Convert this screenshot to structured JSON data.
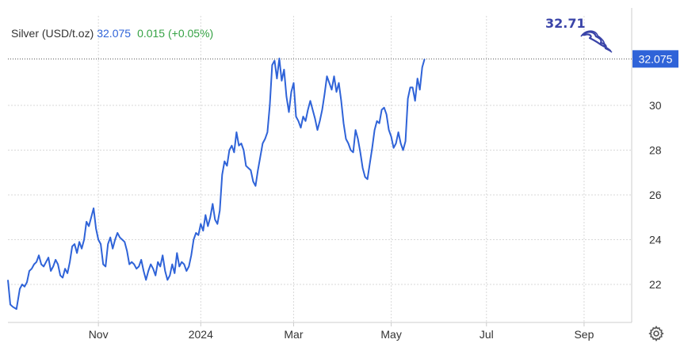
{
  "legend": {
    "name": "Silver (USD/t.oz)",
    "price": "32.075",
    "change": "0.015 (+0.05%)"
  },
  "annotation": "32.71",
  "colors": {
    "line": "#2f63d8",
    "change_positive": "#35a244",
    "grid": "#d9d9d9",
    "axis": "#cccccc",
    "annotation": "#3a44a8",
    "price_tag": "#2f63d8"
  },
  "icons": {
    "settings": "gear-icon"
  },
  "chart_data": {
    "type": "line",
    "title": "",
    "xlabel": "",
    "ylabel": "",
    "ylim": [
      20.3,
      34.0
    ],
    "yticks": [
      22,
      24,
      26,
      28,
      30
    ],
    "y_tick_labels": [
      "22",
      "24",
      "26",
      "28",
      "30"
    ],
    "x_ticks": [
      {
        "label": "Nov",
        "x": 10.1
      },
      {
        "label": "2024",
        "x": 12.25
      },
      {
        "label": "Mar",
        "x": 14.2
      },
      {
        "label": "May",
        "x": 16.25
      },
      {
        "label": "Jul",
        "x": 18.25
      },
      {
        "label": "Sep",
        "x": 20.3
      }
    ],
    "xlim": [
      8.2,
      21.3
    ],
    "grid": true,
    "current_price": 32.075,
    "last_price_line": 32.075,
    "series": [
      {
        "values": [
          [
            8.2,
            22.2
          ],
          [
            8.25,
            21.1
          ],
          [
            8.3,
            21.0
          ],
          [
            8.38,
            20.9
          ],
          [
            8.45,
            21.8
          ],
          [
            8.5,
            22.0
          ],
          [
            8.55,
            21.9
          ],
          [
            8.6,
            22.1
          ],
          [
            8.65,
            22.6
          ],
          [
            8.7,
            22.7
          ],
          [
            8.75,
            22.9
          ],
          [
            8.8,
            23.0
          ],
          [
            8.85,
            23.3
          ],
          [
            8.9,
            22.9
          ],
          [
            8.95,
            22.8
          ],
          [
            9.0,
            23.0
          ],
          [
            9.05,
            23.2
          ],
          [
            9.1,
            22.6
          ],
          [
            9.15,
            22.8
          ],
          [
            9.2,
            23.1
          ],
          [
            9.25,
            22.9
          ],
          [
            9.3,
            22.4
          ],
          [
            9.35,
            22.3
          ],
          [
            9.4,
            22.7
          ],
          [
            9.45,
            22.5
          ],
          [
            9.5,
            23.0
          ],
          [
            9.55,
            23.7
          ],
          [
            9.6,
            23.8
          ],
          [
            9.65,
            23.4
          ],
          [
            9.7,
            23.9
          ],
          [
            9.75,
            23.6
          ],
          [
            9.8,
            24.0
          ],
          [
            9.85,
            24.8
          ],
          [
            9.9,
            24.6
          ],
          [
            9.95,
            25.0
          ],
          [
            10.0,
            25.4
          ],
          [
            10.05,
            24.5
          ],
          [
            10.1,
            24.0
          ],
          [
            10.15,
            23.8
          ],
          [
            10.2,
            22.9
          ],
          [
            10.25,
            22.8
          ],
          [
            10.3,
            23.8
          ],
          [
            10.35,
            24.1
          ],
          [
            10.4,
            23.6
          ],
          [
            10.45,
            24.0
          ],
          [
            10.5,
            24.3
          ],
          [
            10.55,
            24.1
          ],
          [
            10.6,
            24.0
          ],
          [
            10.65,
            23.9
          ],
          [
            10.7,
            23.5
          ],
          [
            10.75,
            22.9
          ],
          [
            10.8,
            23.0
          ],
          [
            10.85,
            22.9
          ],
          [
            10.9,
            22.7
          ],
          [
            10.95,
            22.8
          ],
          [
            11.0,
            23.1
          ],
          [
            11.05,
            22.6
          ],
          [
            11.1,
            22.2
          ],
          [
            11.15,
            22.6
          ],
          [
            11.2,
            22.9
          ],
          [
            11.25,
            22.7
          ],
          [
            11.3,
            22.4
          ],
          [
            11.35,
            23.0
          ],
          [
            11.4,
            22.8
          ],
          [
            11.45,
            23.3
          ],
          [
            11.5,
            22.6
          ],
          [
            11.55,
            22.2
          ],
          [
            11.6,
            22.4
          ],
          [
            11.65,
            22.9
          ],
          [
            11.7,
            22.5
          ],
          [
            11.75,
            23.4
          ],
          [
            11.8,
            22.8
          ],
          [
            11.85,
            23.0
          ],
          [
            11.9,
            22.9
          ],
          [
            11.95,
            22.6
          ],
          [
            12.0,
            22.8
          ],
          [
            12.05,
            23.3
          ],
          [
            12.1,
            24.0
          ],
          [
            12.15,
            24.3
          ],
          [
            12.2,
            24.2
          ],
          [
            12.25,
            24.7
          ],
          [
            12.3,
            24.4
          ],
          [
            12.35,
            25.1
          ],
          [
            12.4,
            24.6
          ],
          [
            12.45,
            25.0
          ],
          [
            12.5,
            25.6
          ],
          [
            12.55,
            24.9
          ],
          [
            12.6,
            24.7
          ],
          [
            12.65,
            25.3
          ],
          [
            12.7,
            26.9
          ],
          [
            12.75,
            27.5
          ],
          [
            12.8,
            27.3
          ],
          [
            12.85,
            28.0
          ],
          [
            12.9,
            28.2
          ],
          [
            12.95,
            27.9
          ],
          [
            13.0,
            28.8
          ],
          [
            13.05,
            28.2
          ],
          [
            13.1,
            28.3
          ],
          [
            13.15,
            28.0
          ],
          [
            13.2,
            27.3
          ],
          [
            13.25,
            27.2
          ],
          [
            13.3,
            27.1
          ],
          [
            13.35,
            26.6
          ],
          [
            13.4,
            26.4
          ],
          [
            13.45,
            27.1
          ],
          [
            13.5,
            27.7
          ],
          [
            13.55,
            28.3
          ],
          [
            13.6,
            28.5
          ],
          [
            13.65,
            28.8
          ],
          [
            13.7,
            30.0
          ],
          [
            13.75,
            31.8
          ],
          [
            13.8,
            32.0
          ],
          [
            13.85,
            31.2
          ],
          [
            13.9,
            32.1
          ],
          [
            13.95,
            31.1
          ],
          [
            14.0,
            31.6
          ],
          [
            14.05,
            30.4
          ],
          [
            14.1,
            29.7
          ],
          [
            14.15,
            30.6
          ],
          [
            14.2,
            31.0
          ],
          [
            14.25,
            29.5
          ],
          [
            14.3,
            29.3
          ],
          [
            14.35,
            29.0
          ],
          [
            14.4,
            29.5
          ],
          [
            14.45,
            29.3
          ],
          [
            14.5,
            29.8
          ],
          [
            14.55,
            30.2
          ],
          [
            14.6,
            29.8
          ],
          [
            14.65,
            29.4
          ],
          [
            14.7,
            28.9
          ],
          [
            14.75,
            29.3
          ],
          [
            14.8,
            29.8
          ],
          [
            14.85,
            30.5
          ],
          [
            14.9,
            31.3
          ],
          [
            14.95,
            31.0
          ],
          [
            15.0,
            30.7
          ],
          [
            15.05,
            31.3
          ],
          [
            15.1,
            30.6
          ],
          [
            15.15,
            31.0
          ],
          [
            15.2,
            30.2
          ],
          [
            15.25,
            29.2
          ],
          [
            15.3,
            28.5
          ],
          [
            15.35,
            28.3
          ],
          [
            15.4,
            28.0
          ],
          [
            15.45,
            27.9
          ],
          [
            15.5,
            28.9
          ],
          [
            15.55,
            28.5
          ],
          [
            15.6,
            27.9
          ],
          [
            15.65,
            27.2
          ],
          [
            15.7,
            26.8
          ],
          [
            15.75,
            26.7
          ],
          [
            15.8,
            27.4
          ],
          [
            15.85,
            28.1
          ],
          [
            15.9,
            28.9
          ],
          [
            15.95,
            29.3
          ],
          [
            16.0,
            29.2
          ],
          [
            16.05,
            29.8
          ],
          [
            16.1,
            29.9
          ],
          [
            16.15,
            29.6
          ],
          [
            16.2,
            28.9
          ],
          [
            16.25,
            28.6
          ],
          [
            16.3,
            28.1
          ],
          [
            16.35,
            28.3
          ],
          [
            16.4,
            28.8
          ],
          [
            16.45,
            28.3
          ],
          [
            16.5,
            28.0
          ],
          [
            16.55,
            28.4
          ],
          [
            16.6,
            30.3
          ],
          [
            16.65,
            30.8
          ],
          [
            16.7,
            30.8
          ],
          [
            16.75,
            30.2
          ],
          [
            16.8,
            31.2
          ],
          [
            16.85,
            30.7
          ],
          [
            16.9,
            31.7
          ],
          [
            16.95,
            32.075
          ]
        ]
      }
    ]
  }
}
